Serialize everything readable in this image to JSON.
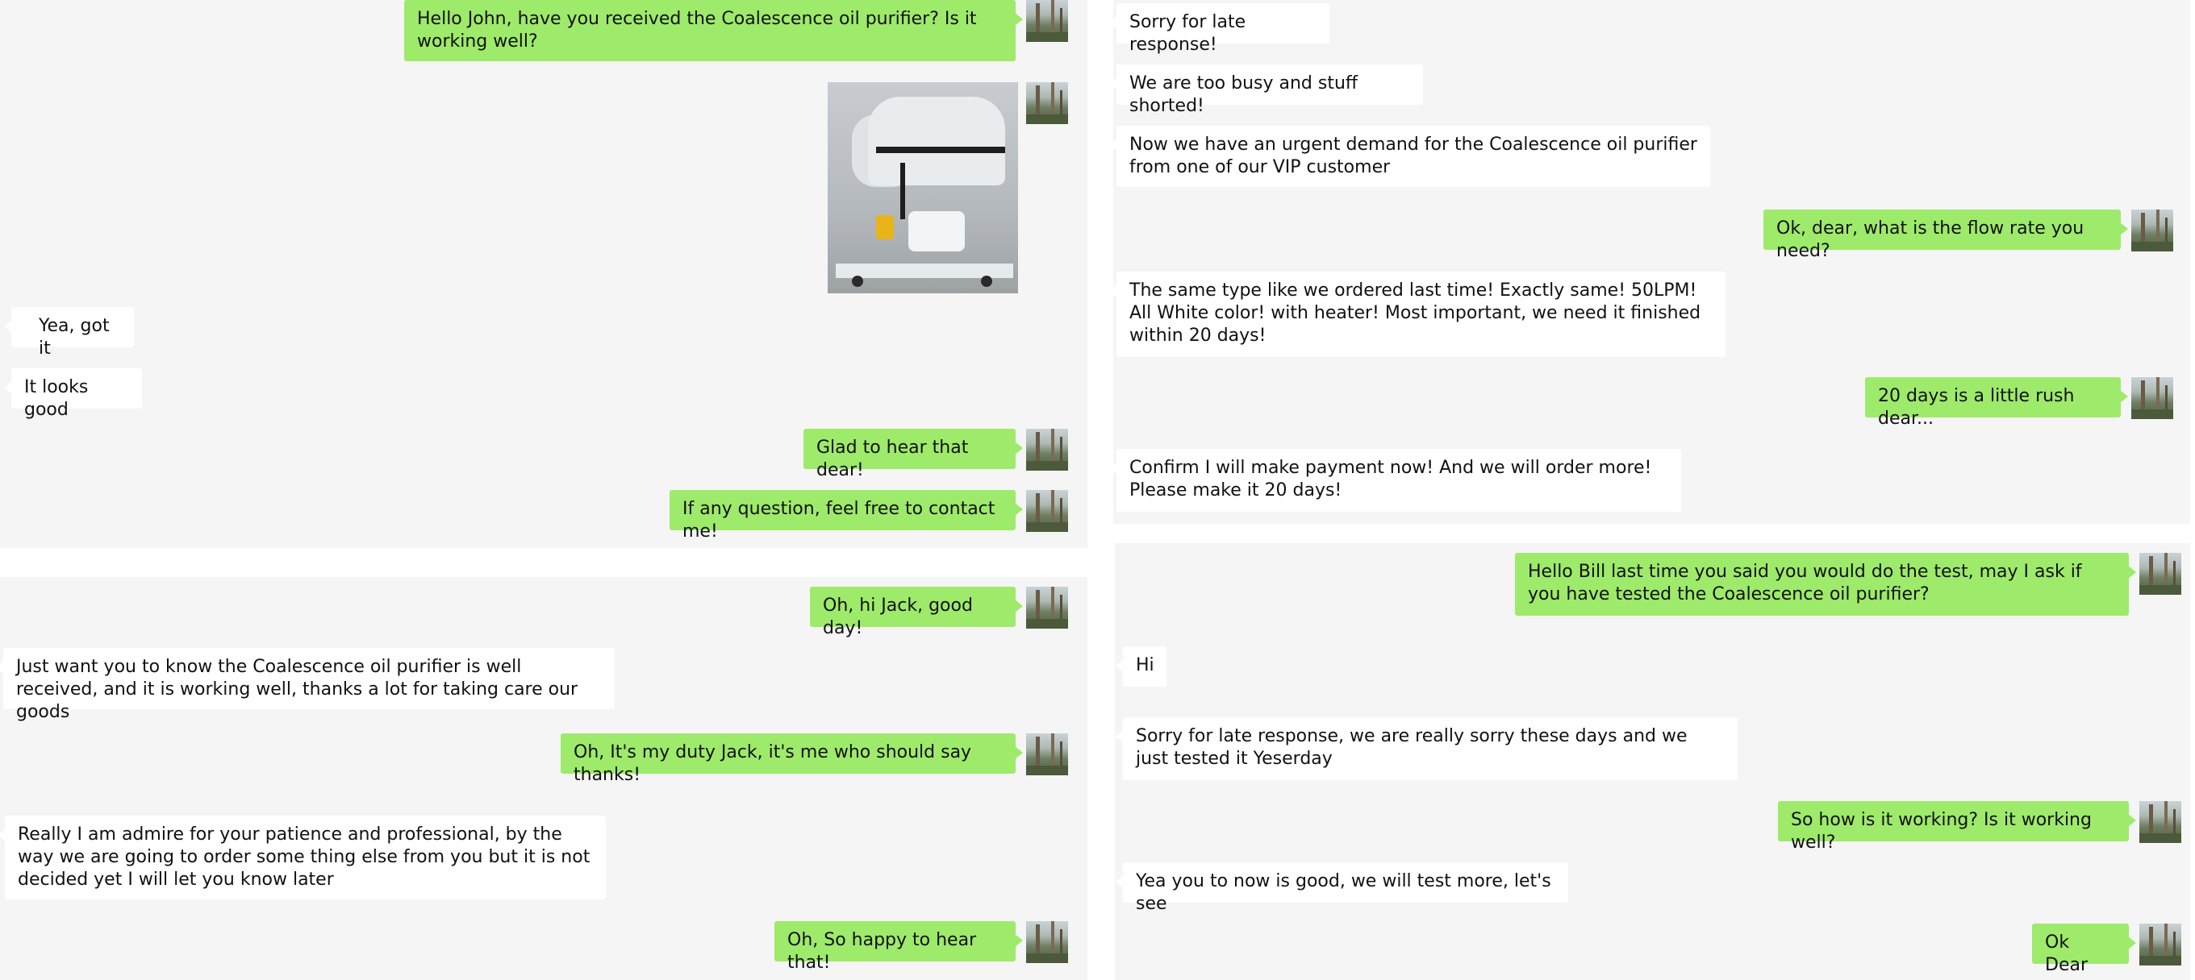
{
  "panel1": {
    "msg1": "Hello John, have you received the Coalescence oil purifier? Is it working well?",
    "photo_icon": "oil-purifier-photo",
    "msg2": "Yea, got it",
    "msg3": "It looks good",
    "msg4": "Glad to hear that dear!",
    "msg5": "If any question, feel free to contact me!"
  },
  "panel2": {
    "msg1": "Oh, hi Jack, good day!",
    "msg2": "Just want you to know the Coalescence oil purifier is well received, and it is working well, thanks a lot for taking care our goods",
    "msg3": "Oh, It's my duty Jack, it's me who should say thanks!",
    "msg4": "Really I am admire for your patience and professional, by the way we are going to order some thing else from you but it is not decided yet I will let you know later",
    "msg5": "Oh, So happy to hear that!"
  },
  "panel3": {
    "msg1": "Sorry for late response!",
    "msg2": "We are too busy and stuff shorted!",
    "msg3": "Now we have an urgent demand for the Coalescence oil purifier from one of our VIP customer",
    "msg4": "Ok, dear, what is the flow rate you need?",
    "msg5": "The same type like we ordered last time! Exactly same! 50LPM! All White color! with heater! Most important, we need it finished within 20 days!",
    "msg6": "20 days is a little rush dear...",
    "msg7": "Confirm I will make payment now! And we will order more! Please make it 20 days!"
  },
  "panel4": {
    "msg1": "Hello Bill last time you said you would do the test, may I ask if you have tested the Coalescence oil purifier?",
    "msg2": "Hi",
    "msg3": "Sorry for late response, we are really sorry these days and we just tested it Yeserday",
    "msg4": "So how is it working? Is it working well?",
    "msg5": "Yea you to now is good, we will test more, let's see",
    "msg6": "Ok Dear"
  },
  "colors": {
    "outgoing_bubble": "#9eea6a",
    "incoming_bubble": "#ffffff",
    "panel_background": "#f5f5f5"
  },
  "avatar_icon": "forest-avatar-icon"
}
